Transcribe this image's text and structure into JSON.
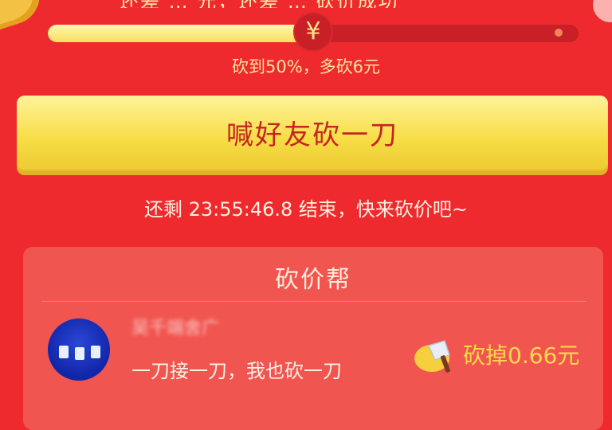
{
  "header": {
    "partial_top_text": "还差 … 元，还差 … 砍价成功"
  },
  "progress": {
    "fraction": 0.5,
    "marker_symbol": "¥",
    "hint": "砍到50%，多砍6元"
  },
  "invite_button": {
    "label": "喊好友砍一刀"
  },
  "countdown": {
    "text": "还剩 23:55:46.8 结束，快来砍价吧~"
  },
  "helpers": {
    "title": "砍价帮",
    "items": [
      {
        "name": "吴千端舍广",
        "message": "一刀接一刀，我也砍一刀",
        "amount": "砍掉0.66元"
      }
    ]
  },
  "icons": {
    "progress_marker": "yen-icon",
    "helper_action": "cleaver-icon"
  },
  "colors": {
    "background": "#ee2a2e",
    "button": "#f7dd46",
    "accent_text": "#ffd94e"
  }
}
